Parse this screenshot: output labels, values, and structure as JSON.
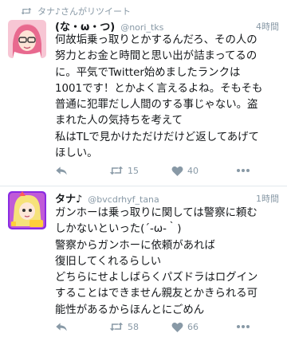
{
  "tweets": [
    {
      "retweet_label": "タナ♪さんがリツイート",
      "name": "(な・ω・つ)",
      "handle": "@nori_tks",
      "time": "4時間",
      "body": "何故垢乗っ取りとかするんだろ、その人の\n努力とお金と時間と思い出が詰まってるの\nに。平気でTwitter始めましたランクは\n1001です！とかよく言えるよね。そもそも\n普通に犯罪だし人間のする事じゃない。盗\nまれた人の気持ちを考えて\n私はTLで見かけただけだけど返してあげて\nほしい。",
      "retweets": "15",
      "likes": "40"
    },
    {
      "name": "タナ♪",
      "handle": "@bvcdrhyf_tana",
      "time": "1時間",
      "body": "ガンホーは乗っ取りに関しては警察に頼む\nしかないといった(´-ω-｀)\n警察からガンホーに依頼があれば\n復旧してくれるらしい\nどちらにせよしばらくパズドラはログイン\nすることはできません親友とかきられる可\n能性があるからほんとにごめん",
      "retweets": "58",
      "likes": "66"
    }
  ],
  "icons": {
    "retweet": "retweet-icon",
    "reply": "reply-icon",
    "like": "heart-icon",
    "more": "more-icon"
  },
  "colors": {
    "meta_gray": "#8899a6",
    "divider": "#e1e8ed",
    "text": "#14171a"
  }
}
